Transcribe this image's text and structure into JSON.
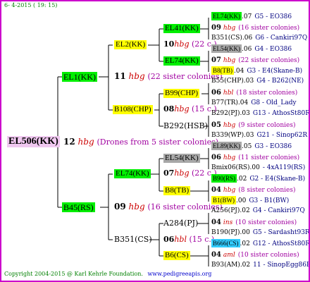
{
  "header": {
    "date": "6- 4-2015 ( 19: 15)"
  },
  "footer": {
    "copyright": "Copyright 2004-2015 @ Karl Kehrle Foundation.",
    "url": "www.pedigreeapis.org"
  },
  "root": {
    "name": "EL506(KK)",
    "drones": "12",
    "hbg": "hbg",
    "desc": "(Drones from 5 sister colonies)"
  },
  "p1": {
    "name": "EL1(KK)",
    "num": "11",
    "hbg": "hbg",
    "desc": "(22 sister colonies)"
  },
  "p2": {
    "name": "B45(RS)",
    "num": "09",
    "hbg": "hbg",
    "desc": "(16 sister colonies)"
  },
  "g1": {
    "name": "EL2(KK)",
    "num": "10",
    "hbg": "hbg",
    "desc": "(22 c.)"
  },
  "g2": {
    "name": "B108(CHP)",
    "num": "08",
    "hbg": "hbg",
    "desc": "(15 c.)"
  },
  "g3": {
    "name": "EL74(KK)",
    "num": "07",
    "hbg": "hbg",
    "desc": "(22 c.)"
  },
  "g4": {
    "name": "B351(CS)",
    "num": "06",
    "hbg": "hbl",
    "desc": "(15 c.)"
  },
  "gg": {
    "a": "EL41(KK)",
    "b": "EL74(KK)",
    "c": "B99(CHP)",
    "d": "B292(HSB)",
    "e": "EL54(KK)",
    "f": "B8(TB)",
    "g": "A284(PJ)",
    "h": "B6(CS)"
  },
  "r1": {
    "pre": "EL74(KK)",
    "num": ".07",
    "code": "G5 - EO386"
  },
  "r2": {
    "num": "09",
    "hbg": "hbg",
    "desc": "(16 sister colonies)"
  },
  "r3": {
    "pre": "B351(CS)",
    "num": ".06",
    "code": "G6 - Cankiri97Q"
  },
  "r4": {
    "pre": "EL54(KK)",
    "num": ".06",
    "code": "G4 - EO386"
  },
  "r5": {
    "num": "07",
    "hbg": "hbg",
    "desc": "(22 sister colonies)"
  },
  "r6": {
    "pre": "B8(TB)",
    "num": ".04",
    "code": "G3 - E4(Skane-B)"
  },
  "r7": {
    "pre": "B55(CHP)",
    "num": ".03",
    "code": "G4 - B262(NE)"
  },
  "r8": {
    "num": "06",
    "hbg": "hbl",
    "desc": "(18 sister colonies)"
  },
  "r9": {
    "pre": "B77(TR)",
    "num": ".04",
    "code": "G8 - Old_Lady"
  },
  "r10": {
    "pre": "B292(PJ)",
    "num": ".03",
    "code": "G13 - AthosSt80R"
  },
  "r11": {
    "num": "05",
    "hbg": "hbg",
    "desc": "(9 sister colonies)"
  },
  "r12": {
    "pre": "B339(WP)",
    "num": ".03",
    "code": "G21 - Sinop62R"
  },
  "r13": {
    "pre": "EL89(KK)",
    "num": ".05",
    "code": "G3 - EO386"
  },
  "r14": {
    "num": "06",
    "hbg": "hbg",
    "desc": "(11 sister colonies)"
  },
  "r15": {
    "pre": "Bmix06(RS)",
    "num": ".00",
    "code": "- 4xA119(RS)"
  },
  "r16": {
    "pre": "B90(RS)",
    "num": ".02",
    "code": "G2 - E4(Skane-B)"
  },
  "r17": {
    "num": "04",
    "hbg": "hbg",
    "desc": "(8 sister colonies)"
  },
  "r18": {
    "pre": "B1(BW)",
    "num": ".00",
    "code": "G3 - B1(BW)"
  },
  "r19": {
    "pre": "A256(PJ)",
    "num": ".02",
    "code": "G4 - Cankiri97Q"
  },
  "r20": {
    "num": "04",
    "hbg": "ins",
    "desc": "(10 sister colonies)"
  },
  "r21": {
    "pre": "B190(PJ)",
    "num": ".00",
    "code": "G5 - Sardasht93R"
  },
  "r22": {
    "pre": "B666(CS)",
    "num": ".02",
    "code": "G12 - AthosSt80R"
  },
  "r23": {
    "num": "04",
    "hbg": "aml",
    "desc": "(10 sister colonies)"
  },
  "r24": {
    "pre": "B93(AM)",
    "num": ".02",
    "code": "11 - SinopEgg86R"
  }
}
